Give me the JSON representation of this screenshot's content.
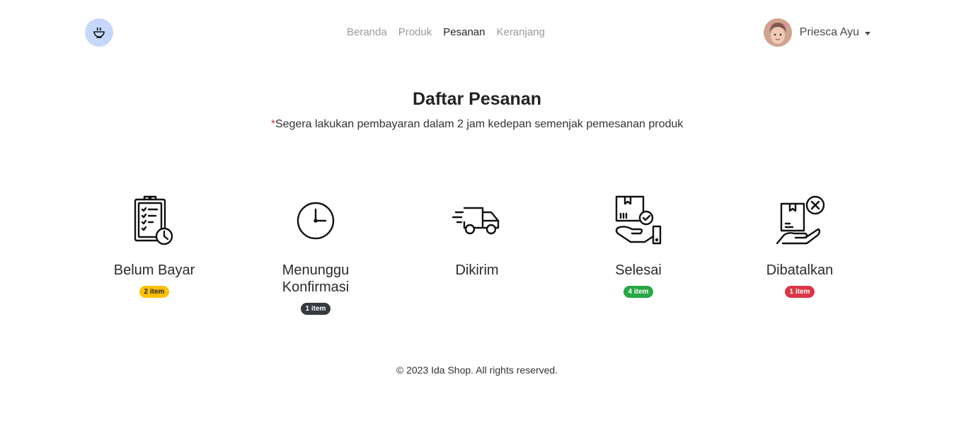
{
  "nav": {
    "items": [
      "Beranda",
      "Produk",
      "Pesanan",
      "Keranjang"
    ],
    "active_index": 2
  },
  "user": {
    "name": "Priesca Ayu"
  },
  "page": {
    "title": "Daftar Pesanan",
    "notice_marker": "*",
    "notice": "Segera lakukan pembayaran dalam 2 jam kedepan semenjak pemesanan produk"
  },
  "statuses": [
    {
      "label": "Belum Bayar",
      "badge": "2 item",
      "badge_color": "#ffc107",
      "icon": "clipboard-clock-icon"
    },
    {
      "label": "Menunggu Konfirmasi",
      "badge": "1 item",
      "badge_color": "#343a40",
      "icon": "clock-icon"
    },
    {
      "label": "Dikirim",
      "badge": "",
      "icon": "delivery-truck-icon"
    },
    {
      "label": "Selesai",
      "badge": "4 item",
      "badge_color": "#28a745",
      "icon": "box-hand-check-icon"
    },
    {
      "label": "Dibatalkan",
      "badge": "1 item",
      "badge_color": "#dc3545",
      "icon": "box-hand-cancel-icon"
    }
  ],
  "footer": {
    "text": "© 2023 Ida Shop. All rights reserved."
  },
  "colors": {
    "logo_bg": "#c5d8fb",
    "accent_red": "#dc3545"
  }
}
